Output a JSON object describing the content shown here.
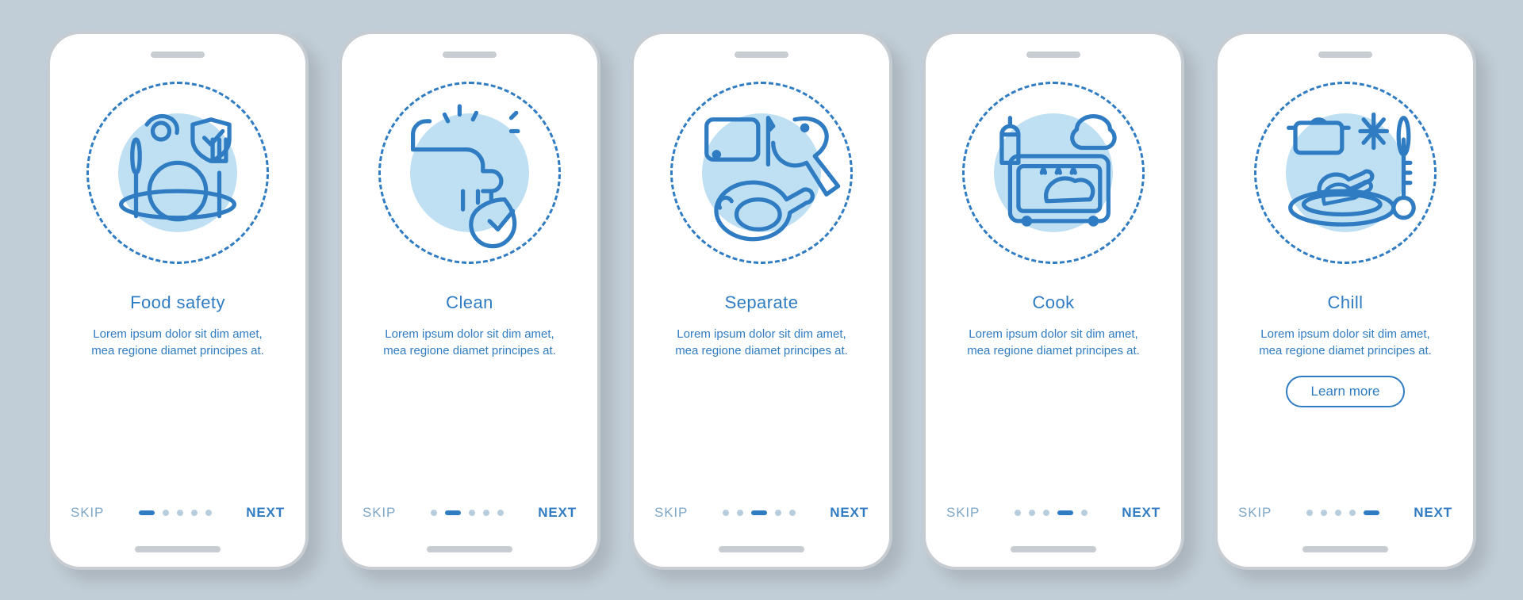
{
  "common": {
    "skip": "SKIP",
    "next": "NEXT",
    "learn_more": "Learn more",
    "description": "Lorem ipsum dolor sit dim amet, mea regione diamet principes at."
  },
  "colors": {
    "primary": "#2f7cc3",
    "accent_light": "#bfe0f2",
    "bg": "#c2ced7"
  },
  "screens": [
    {
      "title": "Food safety",
      "icon": "food-safety-icon",
      "active_dot": 0,
      "show_learn_more": false
    },
    {
      "title": "Clean",
      "icon": "clean-icon",
      "active_dot": 1,
      "show_learn_more": false
    },
    {
      "title": "Separate",
      "icon": "separate-icon",
      "active_dot": 2,
      "show_learn_more": false
    },
    {
      "title": "Cook",
      "icon": "cook-icon",
      "active_dot": 3,
      "show_learn_more": false
    },
    {
      "title": "Chill",
      "icon": "chill-icon",
      "active_dot": 4,
      "show_learn_more": true
    }
  ],
  "total_dots": 5
}
